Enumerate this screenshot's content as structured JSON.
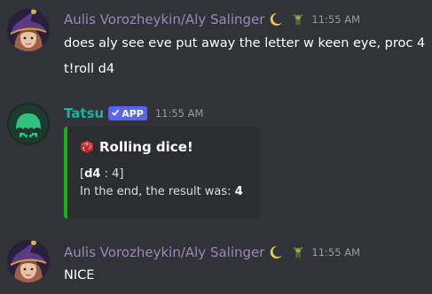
{
  "messages": [
    {
      "username": "Aulis Vorozheykin/Aly Salinger",
      "decorations": [
        "crescent-moon-icon",
        "goblin-figure-icon"
      ],
      "timestamp": "11:55 AM",
      "lines": [
        "does aly see eve put away the letter w keen eye, proc 4",
        "t!roll d4"
      ]
    },
    {
      "username": "Tatsu",
      "badge": "APP",
      "timestamp": "11:55 AM",
      "embed": {
        "icon": "red-dice-icon",
        "title": "Rolling dice!",
        "roll_open": "[",
        "roll_die": "d4",
        "roll_sep": " : 4]",
        "result_prefix": "In the end, the result was: ",
        "result_value": "4",
        "accent_color": "#14b414"
      }
    },
    {
      "username": "Aulis Vorozheykin/Aly Salinger",
      "decorations": [
        "crescent-moon-icon",
        "goblin-figure-icon"
      ],
      "timestamp": "11:55 AM",
      "lines": [
        "NICE"
      ]
    }
  ],
  "colors": {
    "background": "#313338",
    "user_name": "#9a87b8",
    "bot_name": "#1bb39b",
    "badge": "#5865f2",
    "embed_bg": "#2b2d31"
  }
}
